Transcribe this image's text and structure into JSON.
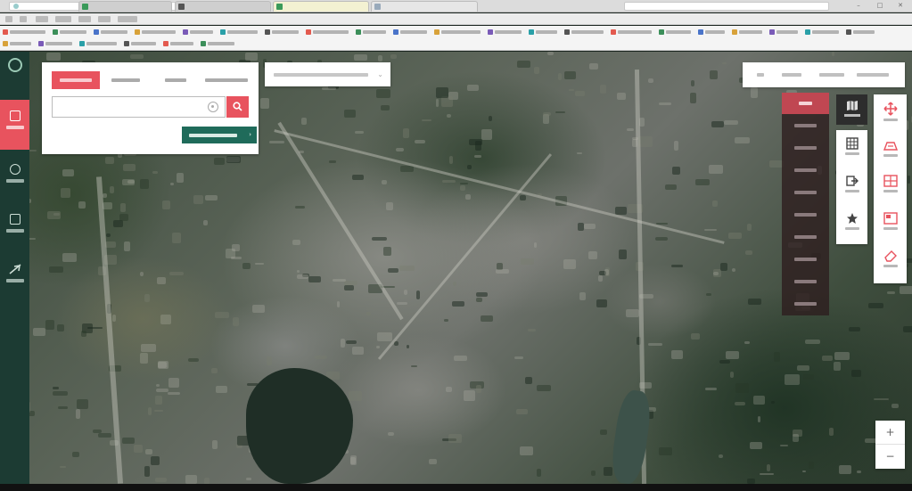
{
  "browser": {
    "url": "",
    "tabs": [
      {
        "label": "",
        "active": false
      },
      {
        "label": "",
        "active": false
      },
      {
        "label": "",
        "active": true
      },
      {
        "label": "",
        "active": false
      }
    ],
    "window_controls": {
      "minimize": "–",
      "maximize": "□",
      "close": "✕"
    }
  },
  "app": {
    "logo_text": "",
    "nav": [
      {
        "icon": "map-search-icon",
        "label": "",
        "active": true
      },
      {
        "icon": "layers-icon",
        "label": "",
        "active": false
      },
      {
        "icon": "document-icon",
        "label": "",
        "active": false
      },
      {
        "icon": "airplane-icon",
        "label": "",
        "active": false
      }
    ]
  },
  "search_panel": {
    "tabs": [
      "",
      "",
      "",
      ""
    ],
    "active_tab": 0,
    "input_value": "",
    "input_placeholder": "",
    "advanced_search_label": "",
    "advanced_chevron": "›"
  },
  "location_select": {
    "value": "",
    "chevron": "⌄"
  },
  "top_right_menu": {
    "items": [
      "",
      "",
      "",
      ""
    ]
  },
  "layer_list": {
    "items": [
      "",
      "",
      "",
      "",
      "",
      "",
      "",
      "",
      "",
      ""
    ],
    "active_index": 0
  },
  "map_tools": {
    "map_type": {
      "icon": "map-type-icon",
      "label": ""
    },
    "column_a": [
      {
        "icon": "grid-icon",
        "label": ""
      },
      {
        "icon": "export-icon",
        "label": ""
      },
      {
        "icon": "star-icon",
        "label": ""
      }
    ],
    "column_b": [
      {
        "icon": "move-icon",
        "label": ""
      },
      {
        "icon": "roadview-icon",
        "label": ""
      },
      {
        "icon": "split-screen-icon",
        "label": ""
      },
      {
        "icon": "compare-icon",
        "label": ""
      },
      {
        "icon": "eraser-icon",
        "label": ""
      }
    ]
  },
  "zoom": {
    "in": "+",
    "out": "−"
  },
  "colors": {
    "accent": "#e8535e",
    "sidebar": "#1c3b33",
    "advanced_button": "#1f6b5a",
    "layer_panel": "#2d1c1e"
  }
}
